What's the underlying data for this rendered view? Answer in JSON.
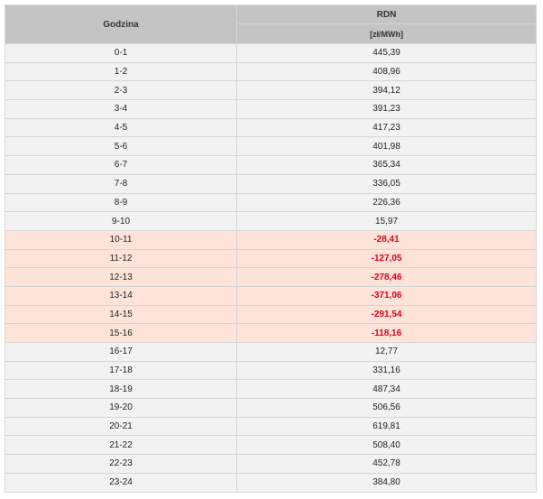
{
  "table": {
    "headers": {
      "hour": "Godzina",
      "price": "RDN",
      "unit": "[zł/MWh]"
    },
    "rows": [
      {
        "hour": "0-1",
        "value": "445,39",
        "negative": false
      },
      {
        "hour": "1-2",
        "value": "408,96",
        "negative": false
      },
      {
        "hour": "2-3",
        "value": "394,12",
        "negative": false
      },
      {
        "hour": "3-4",
        "value": "391,23",
        "negative": false
      },
      {
        "hour": "4-5",
        "value": "417,23",
        "negative": false
      },
      {
        "hour": "5-6",
        "value": "401,98",
        "negative": false
      },
      {
        "hour": "6-7",
        "value": "365,34",
        "negative": false
      },
      {
        "hour": "7-8",
        "value": "336,05",
        "negative": false
      },
      {
        "hour": "8-9",
        "value": "226,36",
        "negative": false
      },
      {
        "hour": "9-10",
        "value": "15,97",
        "negative": false
      },
      {
        "hour": "10-11",
        "value": "-28,41",
        "negative": true
      },
      {
        "hour": "11-12",
        "value": "-127,05",
        "negative": true
      },
      {
        "hour": "12-13",
        "value": "-278,46",
        "negative": true
      },
      {
        "hour": "13-14",
        "value": "-371,06",
        "negative": true
      },
      {
        "hour": "14-15",
        "value": "-291,54",
        "negative": true
      },
      {
        "hour": "15-16",
        "value": "-118,16",
        "negative": true
      },
      {
        "hour": "16-17",
        "value": "12,77",
        "negative": false
      },
      {
        "hour": "17-18",
        "value": "331,16",
        "negative": false
      },
      {
        "hour": "18-19",
        "value": "487,34",
        "negative": false
      },
      {
        "hour": "19-20",
        "value": "506,56",
        "negative": false
      },
      {
        "hour": "20-21",
        "value": "619,81",
        "negative": false
      },
      {
        "hour": "21-22",
        "value": "508,40",
        "negative": false
      },
      {
        "hour": "22-23",
        "value": "452,78",
        "negative": false
      },
      {
        "hour": "23-24",
        "value": "384,80",
        "negative": false
      }
    ]
  },
  "colors": {
    "header_bg": "#c4c4c4",
    "row_bg": "#f2f2f2",
    "negative_row_bg": "#fde3d8",
    "negative_text": "#e0001a"
  }
}
